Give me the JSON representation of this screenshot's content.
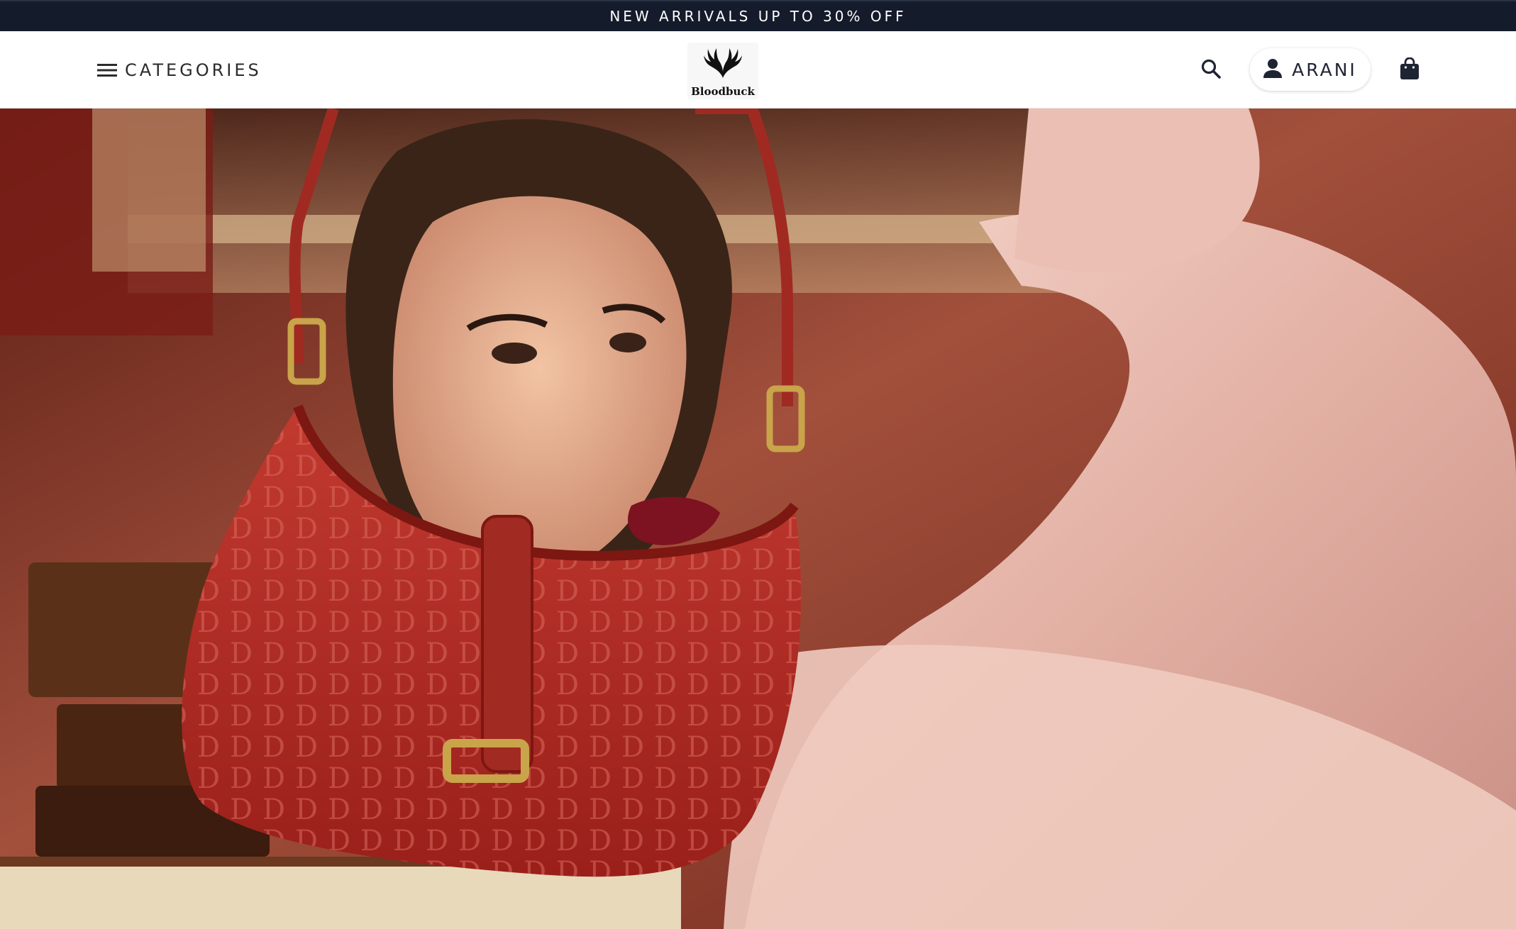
{
  "announcement": {
    "text": "NEW ARRIVALS UP TO 30% OFF"
  },
  "header": {
    "categories_label": "CATEGORIES",
    "logo_text": "Bloodbuck",
    "account_label": "ARANI"
  },
  "icons": {
    "menu": "hamburger-menu-icon",
    "search": "magnifier-icon",
    "account": "person-icon",
    "bag": "shopping-bag-icon"
  },
  "colors": {
    "announcement_bg": "#141b2b",
    "header_bg": "#ffffff",
    "icon_color": "#1f2433"
  }
}
